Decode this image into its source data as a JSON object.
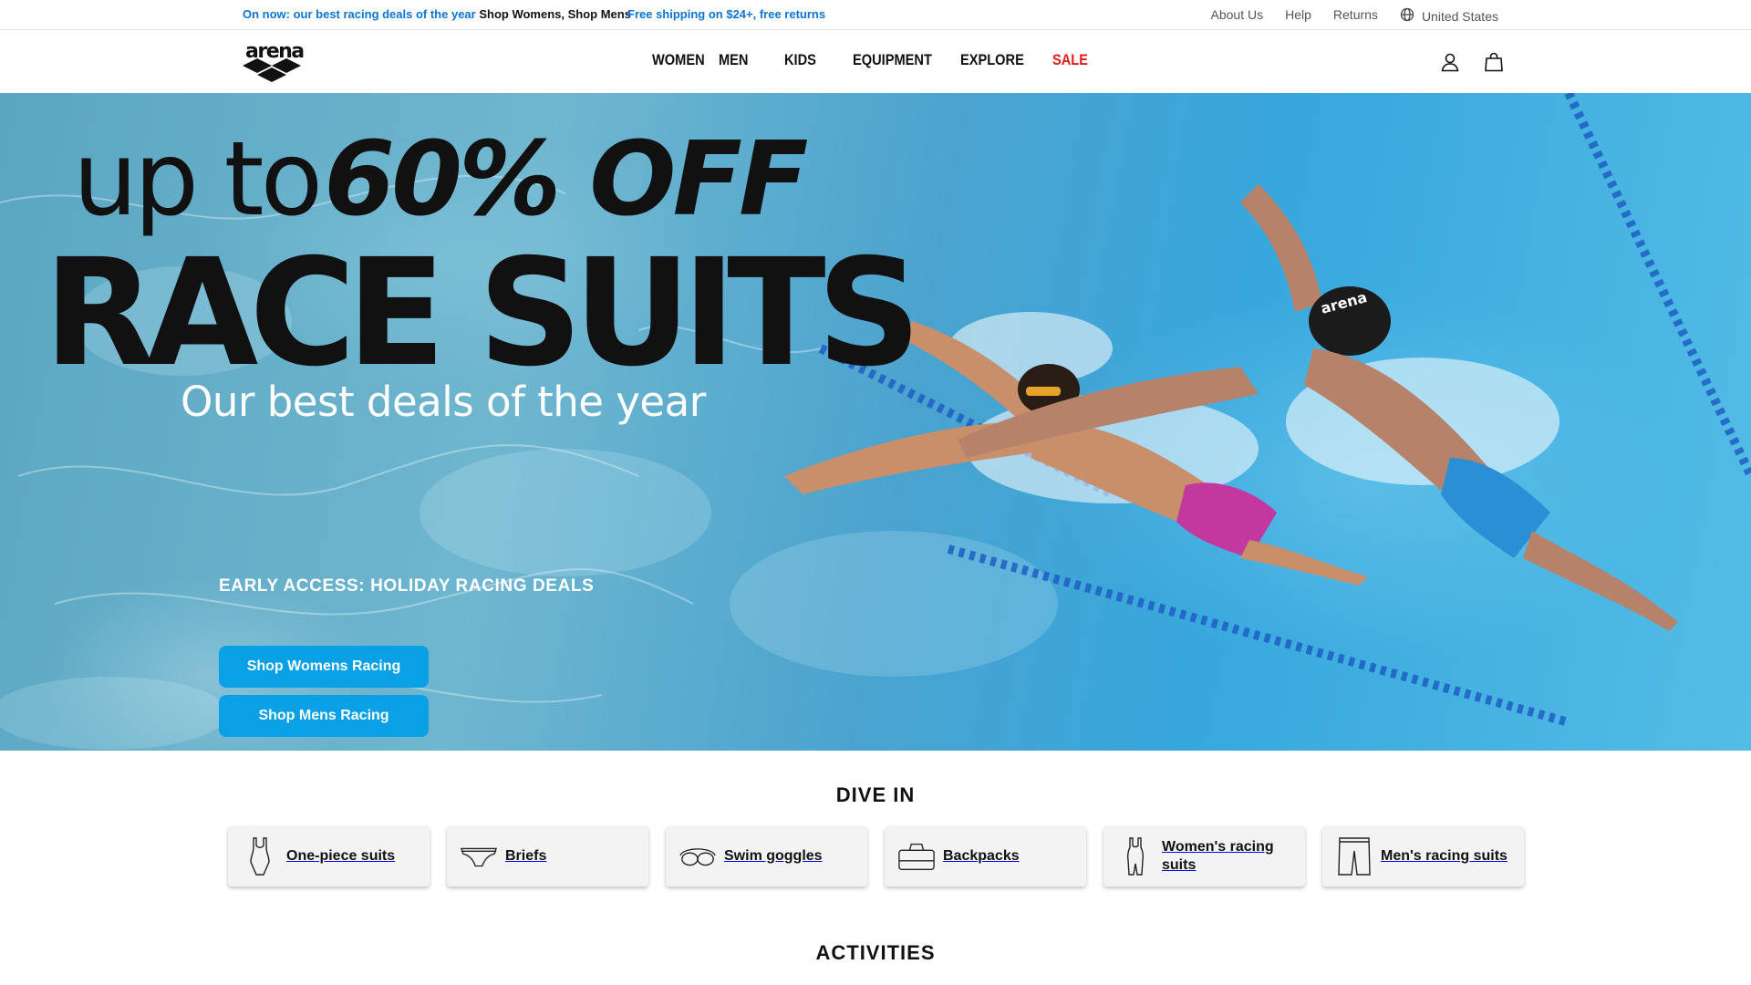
{
  "topbar": {
    "promo_lead": "On now: our best racing deals of the year",
    "shop_womens": "Shop Womens,",
    "shop_mens": "Shop Mens",
    "shipping": "Free shipping on $24+, free returns",
    "about": "About Us",
    "help": "Help",
    "returns": "Returns",
    "region": "United States",
    "region_icon": "globe-icon"
  },
  "header": {
    "logo_text": "arena",
    "nav": [
      "WOMEN",
      "MEN",
      "KIDS",
      "EQUIPMENT",
      "EXPLORE",
      "SALE"
    ],
    "account_icon": "user-icon",
    "cart_icon": "bag-icon",
    "sale_color": "#e01a1a"
  },
  "hero": {
    "headline_prefix": "up to",
    "headline_highlight": "60% OFF",
    "headline_main": "RACE SUITS",
    "subtitle": "Our best deals of the year",
    "early_access": "EARLY ACCESS: HOLIDAY RACING DEALS",
    "cta_women": "Shop Womens Racing",
    "cta_men": "Shop Mens Racing",
    "cta_color": "#0aa0e6"
  },
  "dive_in": {
    "title": "DIVE IN",
    "categories": [
      {
        "label": "One-piece suits",
        "icon": "swimsuit-icon"
      },
      {
        "label": "Briefs",
        "icon": "briefs-icon"
      },
      {
        "label": "Swim goggles",
        "icon": "goggles-icon"
      },
      {
        "label": "Backpacks",
        "icon": "backpack-icon"
      },
      {
        "label": "Women's racing suits",
        "icon": "racing-suit-icon"
      },
      {
        "label": "Men's racing suits",
        "icon": "jammer-icon"
      }
    ]
  },
  "activities": {
    "title": "ACTIVITIES"
  }
}
